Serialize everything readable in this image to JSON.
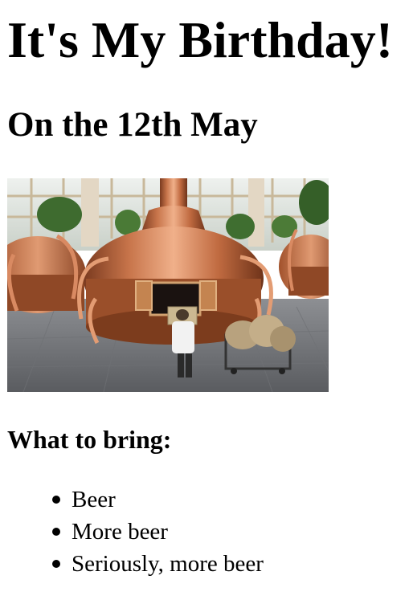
{
  "page": {
    "title": "It's My Birthday!",
    "subtitle": "On the 12th May",
    "photo": {
      "subject": "copper brewing kettle in brewery hall"
    },
    "bring_heading": "What to bring:",
    "bring_items": [
      {
        "label": "Beer"
      },
      {
        "label": "More beer"
      },
      {
        "label": "Seriously, more beer"
      }
    ]
  },
  "colors": {
    "text": "#000000",
    "background": "#ffffff",
    "copper": "#c77a4f"
  }
}
